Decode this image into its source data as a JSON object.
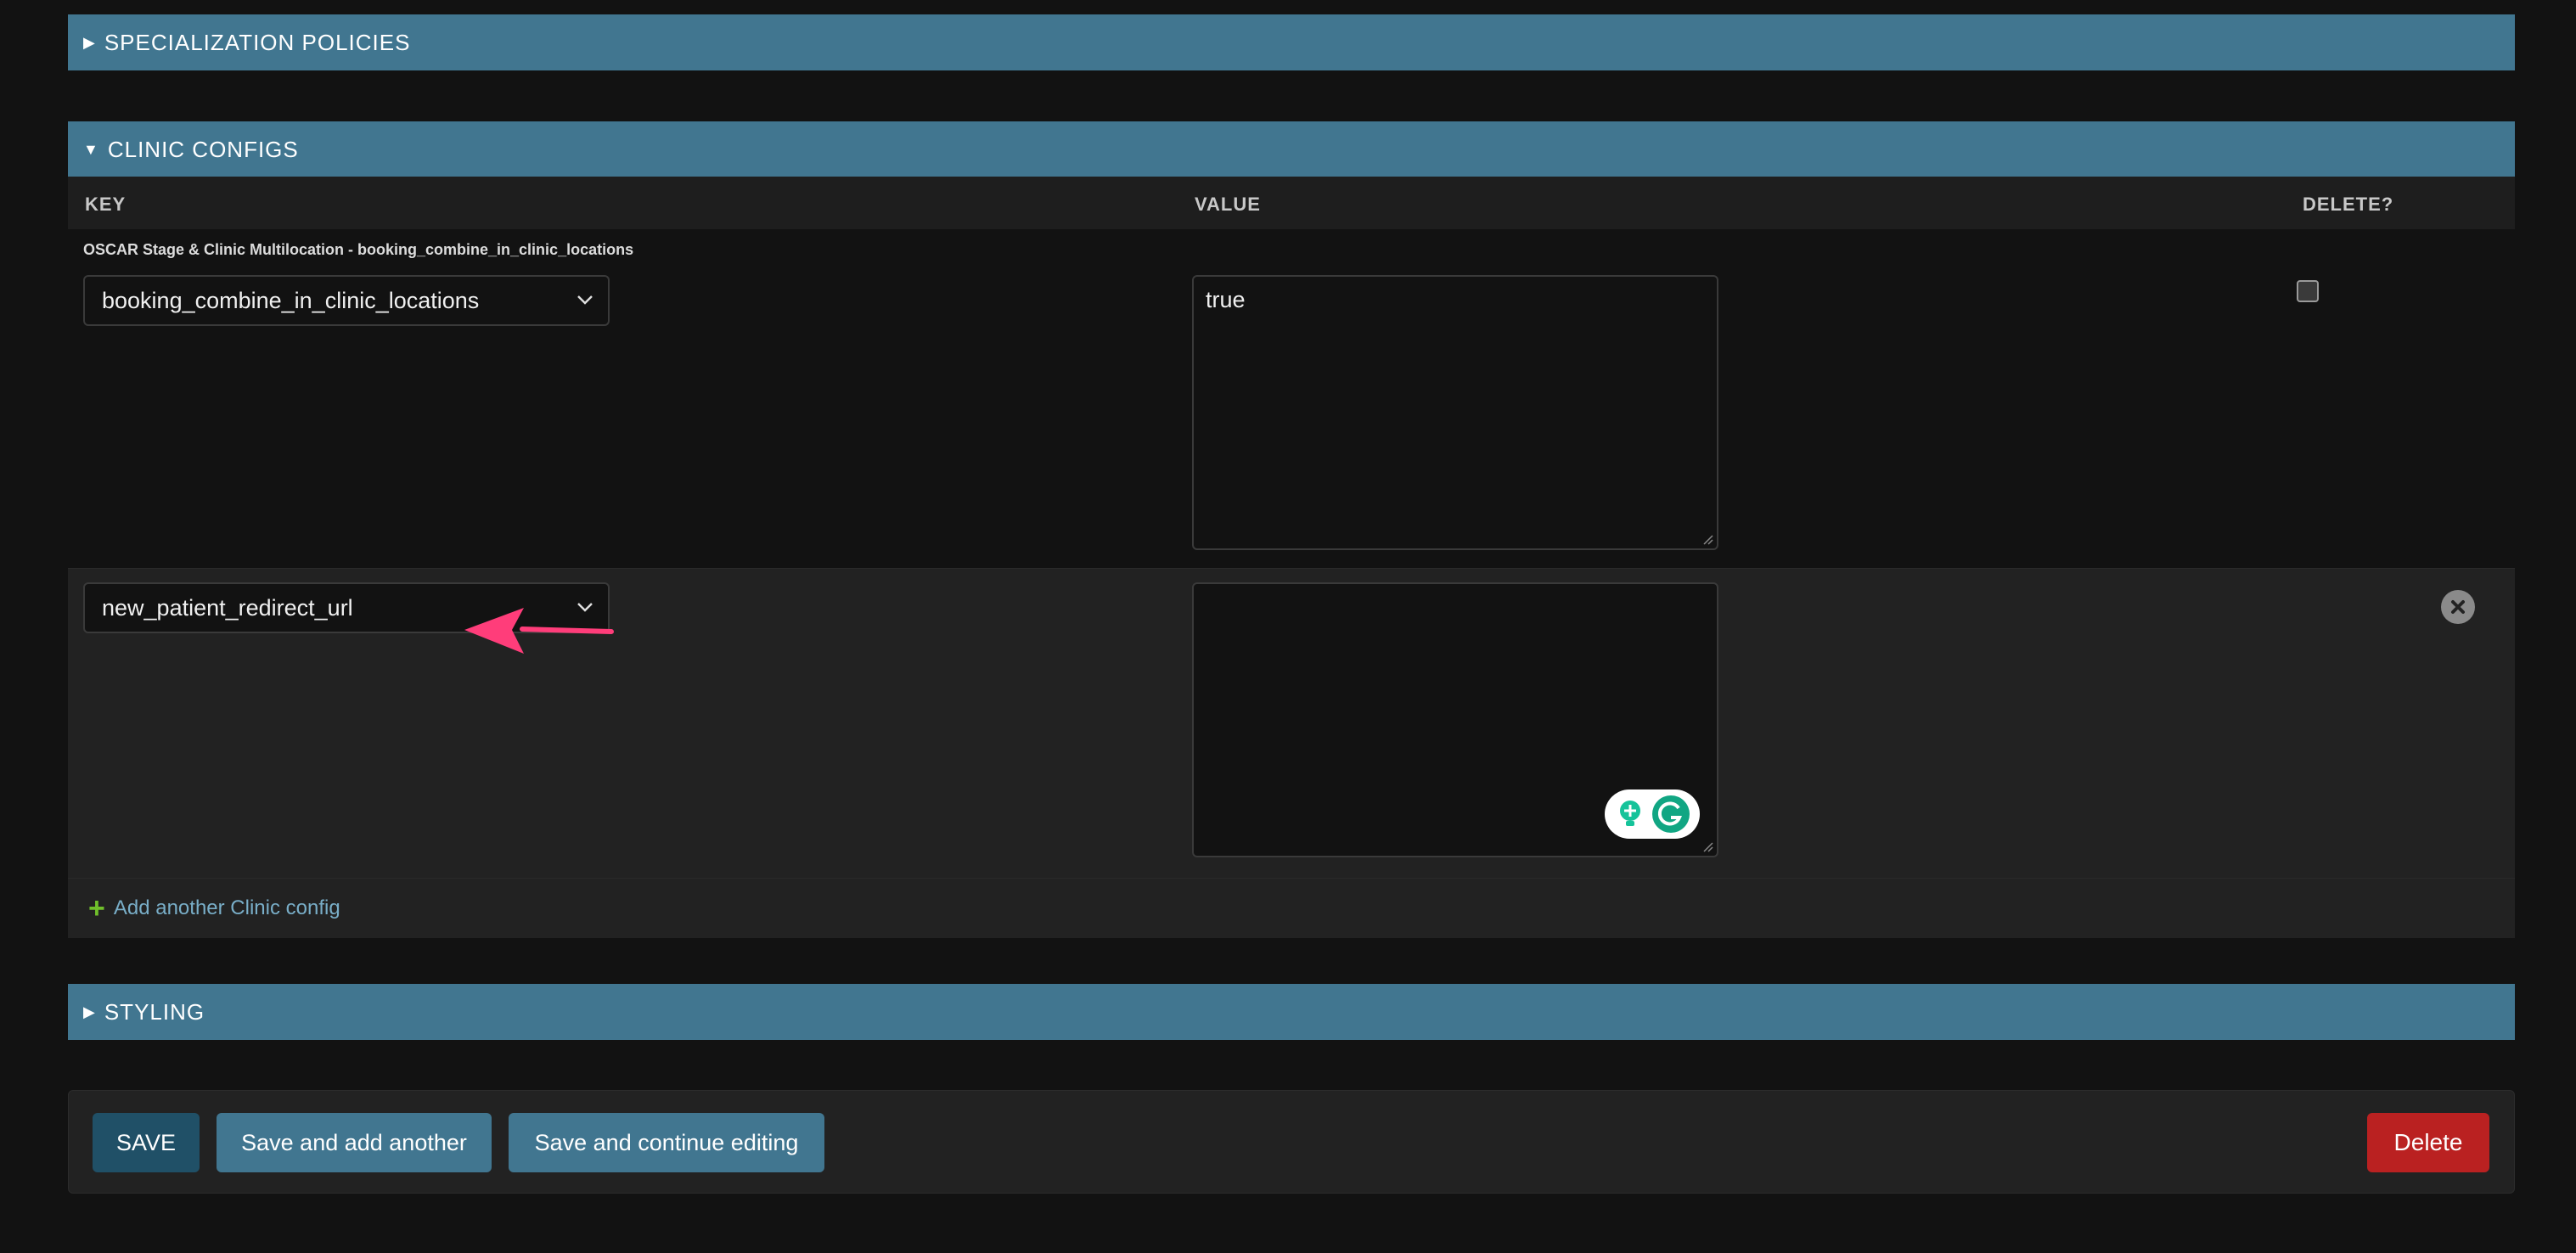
{
  "sections": {
    "specialization": {
      "title": "SPECIALIZATION POLICIES",
      "toggle": "▶"
    },
    "clinic_configs": {
      "title": "CLINIC CONFIGS",
      "toggle": "▼"
    },
    "styling": {
      "title": "STYLING",
      "toggle": "▶"
    }
  },
  "table": {
    "headers": {
      "key": "KEY",
      "value": "VALUE",
      "delete": "DELETE?"
    },
    "rows": [
      {
        "original_label": "OSCAR Stage & Clinic Multilocation - booking_combine_in_clinic_locations",
        "key": "booking_combine_in_clinic_locations",
        "value": "true",
        "delete_checked": false
      },
      {
        "key": "new_patient_redirect_url",
        "value": ""
      }
    ],
    "add_link": "Add another Clinic config"
  },
  "colors": {
    "header_bg": "#417690",
    "annotation_arrow": "#ff3d7a",
    "delete_button": "#ba2121"
  },
  "icons": {
    "select_chevron": "chevron-down-icon",
    "remove_inline": "close-circle-icon",
    "add": "plus-icon",
    "annotation": "arrow-left-icon",
    "grammarly_assist": "grammarly-bulb-icon",
    "grammarly": "grammarly-g-icon"
  },
  "submit_row": {
    "save": "SAVE",
    "save_add": "Save and add another",
    "save_continue": "Save and continue editing",
    "delete": "Delete"
  }
}
